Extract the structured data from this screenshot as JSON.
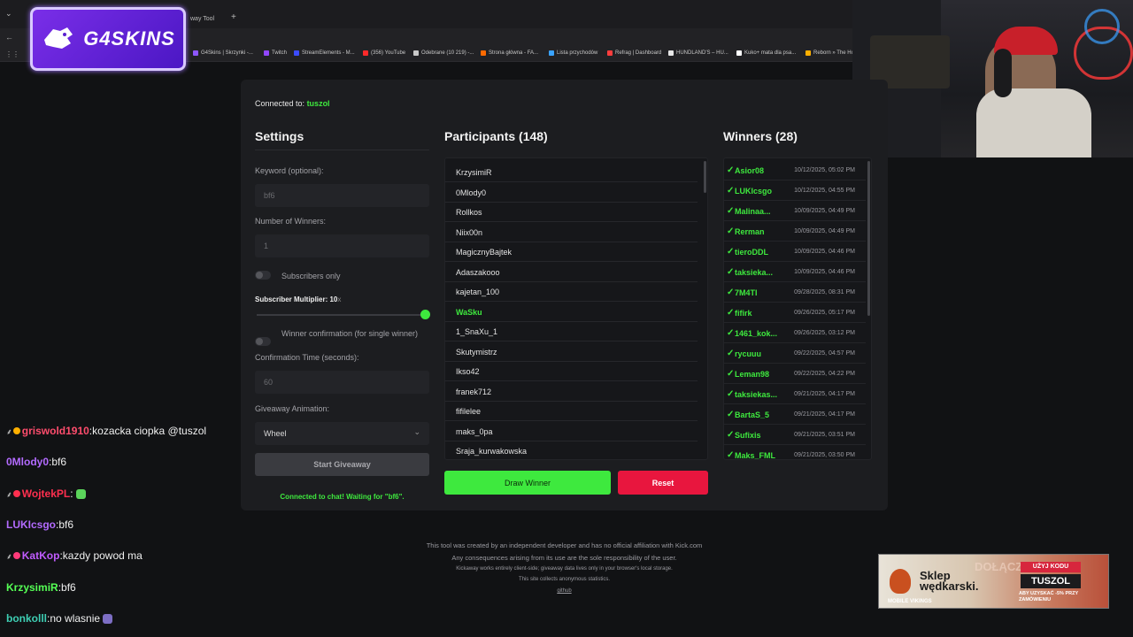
{
  "browser": {
    "tab_title": "way Tool",
    "new_tab": "+",
    "bookmarks": [
      {
        "label": "G4Skins | Skrzynki -...",
        "color": "#8e57ff"
      },
      {
        "label": "Twitch",
        "color": "#9146ff"
      },
      {
        "label": "StreamElements - M...",
        "color": "#3b4cff"
      },
      {
        "label": "(356) YouTube",
        "color": "#ff2a2a"
      },
      {
        "label": "Odebrane (10 219) -...",
        "color": "#c9c9c9"
      },
      {
        "label": "Strona główna - FA...",
        "color": "#ff6a00"
      },
      {
        "label": "Lista przychodów",
        "color": "#3aa3ff"
      },
      {
        "label": "Refrag | Dashboard",
        "color": "#ff3d3d"
      },
      {
        "label": "HUNDLAND'S – HU...",
        "color": "#e6e6e6"
      },
      {
        "label": "Kuko+ mata dla psa...",
        "color": "#ffffff"
      },
      {
        "label": "Reborn » The Ho",
        "color": "#ffb000"
      }
    ]
  },
  "logo": {
    "text": "G4SKINS"
  },
  "app": {
    "connected_prefix": "Connected to:",
    "connected_channel": "tuszol",
    "settings": {
      "title": "Settings",
      "keyword_label": "Keyword (optional):",
      "keyword_placeholder": "bf6",
      "winners_label": "Number of Winners:",
      "winners_placeholder": "1",
      "subs_only_label": "Subscribers only",
      "multiplier_label": "Subscriber Multiplier: 10",
      "multiplier_unit": "x",
      "multiplier_level": 1.0,
      "confirm_label": "Winner confirmation (for single winner)",
      "confirm_time_label": "Confirmation Time (seconds):",
      "confirm_time_placeholder": "60",
      "animation_label": "Giveaway Animation:",
      "animation_value": "Wheel",
      "start_button": "Start Giveaway",
      "status": "Connected to chat! Waiting for \"bf6\"."
    },
    "participants": {
      "title": "Participants (148)",
      "items": [
        {
          "name": "KrzysimiR",
          "highlight": false
        },
        {
          "name": "0Mlody0",
          "highlight": false
        },
        {
          "name": "Rollkos",
          "highlight": false
        },
        {
          "name": "Niix00n",
          "highlight": false
        },
        {
          "name": "MagicznyBajtek",
          "highlight": false
        },
        {
          "name": "Adaszakooo",
          "highlight": false
        },
        {
          "name": "kajetan_100",
          "highlight": false
        },
        {
          "name": "WaSku",
          "highlight": true
        },
        {
          "name": "1_SnaXu_1",
          "highlight": false
        },
        {
          "name": "Skutymistrz",
          "highlight": false
        },
        {
          "name": "Ikso42",
          "highlight": false
        },
        {
          "name": "franek712",
          "highlight": false
        },
        {
          "name": "fifilelee",
          "highlight": false
        },
        {
          "name": "maks_0pa",
          "highlight": false
        },
        {
          "name": "Sraja_kurwakowska",
          "highlight": false
        }
      ],
      "draw_button": "Draw Winner",
      "reset_button": "Reset"
    },
    "winners": {
      "title": "Winners (28)",
      "items": [
        {
          "name": "Asior08",
          "date": "10/12/2025, 05:02 PM"
        },
        {
          "name": "LUKIcsgo",
          "date": "10/12/2025, 04:55 PM"
        },
        {
          "name": "Malinaa...",
          "date": "10/09/2025, 04:49 PM"
        },
        {
          "name": "Rerman",
          "date": "10/09/2025, 04:49 PM"
        },
        {
          "name": "tieroDDL",
          "date": "10/09/2025, 04:46 PM"
        },
        {
          "name": "taksieka...",
          "date": "10/09/2025, 04:46 PM"
        },
        {
          "name": "7M4TI",
          "date": "09/28/2025, 08:31 PM"
        },
        {
          "name": "fifirk",
          "date": "09/26/2025, 05:17 PM"
        },
        {
          "name": "1461_kok...",
          "date": "09/26/2025, 03:12 PM"
        },
        {
          "name": "rycuuu",
          "date": "09/22/2025, 04:57 PM"
        },
        {
          "name": "Leman98",
          "date": "09/22/2025, 04:22 PM"
        },
        {
          "name": "taksiekas...",
          "date": "09/21/2025, 04:17 PM"
        },
        {
          "name": "BartaS_5",
          "date": "09/21/2025, 04:17 PM"
        },
        {
          "name": "Sufixis",
          "date": "09/21/2025, 03:51 PM"
        },
        {
          "name": "Maks_FML",
          "date": "09/21/2025, 03:50 PM"
        }
      ]
    }
  },
  "footer": {
    "line1": "This tool was created by an independent developer and has no official affiliation with Kick.com",
    "line2": "Any consequences arising from its use are the sole responsibility of the user.",
    "line3": "Kickaway works entirely client-side; giveaway data lives only in your browser's local storage.",
    "line4": "This site collects anonymous statistics.",
    "link": "github"
  },
  "chat": [
    {
      "user": "griswold1910",
      "color": "#ff4d6d",
      "text": "kozacka ciopka @tuszol",
      "badge": true,
      "badge_color": "#ffb000"
    },
    {
      "user": "0Mlody0",
      "color": "#b36bff",
      "text": "bf6",
      "badge": false,
      "badge_color": ""
    },
    {
      "user": "WojtekPL",
      "color": "#ff2f4f",
      "text": "",
      "badge": true,
      "badge_color": "#ff2f4f",
      "emote": true
    },
    {
      "user": "LUKIcsgo",
      "color": "#b36bff",
      "text": "bf6",
      "badge": false,
      "badge_color": ""
    },
    {
      "user": "KatKop",
      "color": "#c15cff",
      "text": "kazdy powod ma",
      "badge": true,
      "badge_color": "#ff3a7a"
    },
    {
      "user": "KrzysimiR",
      "color": "#55ff55",
      "text": "bf6",
      "badge": false,
      "badge_color": ""
    },
    {
      "user": "bonkolll",
      "color": "#3ecfb4",
      "text": "no wlasnie",
      "badge": false,
      "badge_color": "",
      "emote": true
    }
  ],
  "ad": {
    "shop": "Sklep",
    "shop2": "wędkarski.",
    "brand": "MOBILE VIKINGS",
    "join": "DOŁĄCZ DO",
    "use_code": "UŻYJ KODU",
    "code": "TUSZOL",
    "promo": "ABY UZYSKAĆ -5% PRZY ZAMÓWIENIU"
  }
}
